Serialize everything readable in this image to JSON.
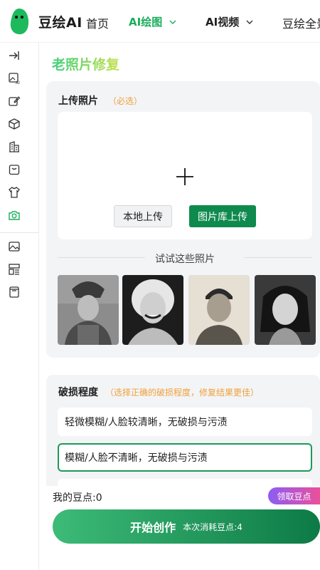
{
  "header": {
    "brand": "豆绘AI",
    "nav_home": "首页",
    "nav_ai_paint": "AI绘图",
    "nav_ai_video": "AI视频",
    "nav_more": "豆绘全景",
    "active_color": "#1aad5b"
  },
  "sidebar": {
    "icons": [
      "collapse-icon",
      "ai-image-icon",
      "edit-image-icon",
      "cube-icon",
      "building-icon",
      "bag-icon",
      "shirt-icon",
      "camera-icon",
      "gallery-icon",
      "layout-icon",
      "document-icon"
    ],
    "active": "camera-icon"
  },
  "main": {
    "page_title": "老照片修复",
    "upload_label": "上传照片",
    "required_hint": "（必选）",
    "local_upload": "本地上传",
    "gallery_upload": "图片库上传",
    "try_label": "试试这些照片",
    "samples": [
      "sample-photo-1",
      "sample-photo-2",
      "sample-photo-3",
      "sample-photo-4"
    ]
  },
  "damage": {
    "title": "破损程度",
    "hint": "（选择正确的破损程度，修复结果更佳）",
    "options": [
      "轻微模糊/人脸较清晰，无破损与污渍",
      "模糊/人脸不清晰，无破损与污渍"
    ],
    "selected_index": 1
  },
  "footer": {
    "beans_text": "我的豆点:0",
    "claim_label": "领取豆点",
    "start_label": "开始创作",
    "cost_text": "本次消耗豆点:4"
  },
  "colors": {
    "primary": "#0f8a4e",
    "accent_green": "#1a9b58",
    "hint_orange": "#f0a03c"
  }
}
